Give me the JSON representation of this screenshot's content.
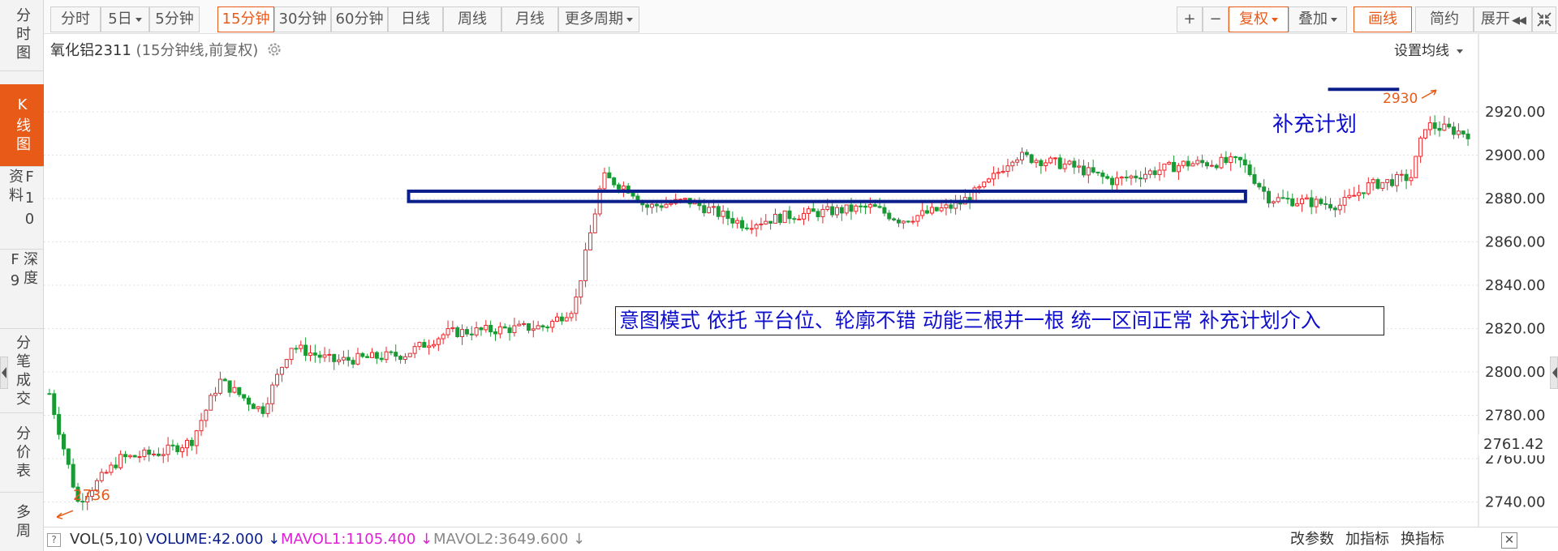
{
  "left_tabs": [
    {
      "label": "分时图",
      "active": false
    },
    {
      "label": "K线图",
      "active": true
    },
    {
      "label": "F10资料",
      "active": false
    },
    {
      "label": "深度F9",
      "active": false
    },
    {
      "label": "分笔成交",
      "active": false
    },
    {
      "label": "分价表",
      "active": false
    },
    {
      "label": "多周",
      "active": false
    }
  ],
  "toolbar": {
    "periods": [
      {
        "label": "分时",
        "dropdown": false,
        "active": false
      },
      {
        "label": "5日",
        "dropdown": true,
        "active": false
      },
      {
        "label": "5分钟",
        "dropdown": false,
        "active": false
      },
      {
        "label": "15分钟",
        "dropdown": false,
        "active": true
      },
      {
        "label": "30分钟",
        "dropdown": false,
        "active": false
      },
      {
        "label": "60分钟",
        "dropdown": false,
        "active": false
      },
      {
        "label": "日线",
        "dropdown": false,
        "active": false
      },
      {
        "label": "周线",
        "dropdown": false,
        "active": false
      },
      {
        "label": "月线",
        "dropdown": false,
        "active": false
      },
      {
        "label": "更多周期",
        "dropdown": true,
        "active": false
      }
    ],
    "zoom_in": "+",
    "zoom_out": "−",
    "fuquan": "复权",
    "overlay": "叠加",
    "draw_line": "画线",
    "simple": "简约",
    "expand": "展开",
    "expand_icon": "double-left-arrow",
    "fullscreen_icon": "shrink-arrows-icon"
  },
  "instrument": {
    "name": "氧化铝2311",
    "desc": "(15分钟线,前复权)"
  },
  "set_ma_label": "设置均线",
  "price_axis": {
    "ticks": [
      "2920.00",
      "2900.00",
      "2880.00",
      "2860.00",
      "2840.00",
      "2820.00",
      "2800.00",
      "2780.00",
      "2760.00",
      "2740.00"
    ],
    "current_price": "2761.42"
  },
  "annotations": {
    "box_text": "意图模式 依托 平台位、轮廓不错 动能三根并一根 统一区间正常 补充计划介入",
    "plan_text": "补充计划",
    "low_label": "2736",
    "high_label": "2930"
  },
  "volume_bar": {
    "help": "?",
    "vol": "VOL(5,10)",
    "volume": "VOLUME:42.000",
    "mavol1": "MAVOL1:1105.400",
    "mavol2": "MAVOL2:3649.600",
    "params": "改参数",
    "add_indicator": "加指标",
    "switch_indicator": "换指标",
    "close": "✕"
  },
  "colors": {
    "up": "#e8262b",
    "down": "#1a9a35",
    "accent": "#e85a17",
    "annotation": "#1010cc",
    "magenta": "#e01fd7",
    "navy": "#0a1f8c"
  },
  "chart_data": {
    "type": "candlestick",
    "y_unit": "price",
    "ylim": [
      2730,
      2935
    ],
    "ticks": [
      2740,
      2760,
      2780,
      2800,
      2820,
      2840,
      2860,
      2880,
      2900,
      2920
    ],
    "segments": [
      {
        "from": 0,
        "to": 2790
      },
      {
        "from": 0.02,
        "to": 2740
      },
      {
        "from": 0.05,
        "to": 2760
      },
      {
        "from": 0.08,
        "to": 2763
      },
      {
        "from": 0.1,
        "to": 2768
      },
      {
        "from": 0.12,
        "to": 2796
      },
      {
        "from": 0.15,
        "to": 2782
      },
      {
        "from": 0.17,
        "to": 2812
      },
      {
        "from": 0.2,
        "to": 2805
      },
      {
        "from": 0.25,
        "to": 2808
      },
      {
        "from": 0.28,
        "to": 2818
      },
      {
        "from": 0.35,
        "to": 2821
      },
      {
        "from": 0.37,
        "to": 2830
      },
      {
        "from": 0.39,
        "to": 2890
      },
      {
        "from": 0.41,
        "to": 2884
      },
      {
        "from": 0.42,
        "to": 2876
      },
      {
        "from": 0.45,
        "to": 2879
      },
      {
        "from": 0.49,
        "to": 2868
      },
      {
        "from": 0.52,
        "to": 2872
      },
      {
        "from": 0.58,
        "to": 2876
      },
      {
        "from": 0.6,
        "to": 2870
      },
      {
        "from": 0.64,
        "to": 2877
      },
      {
        "from": 0.66,
        "to": 2886
      },
      {
        "from": 0.68,
        "to": 2900
      },
      {
        "from": 0.72,
        "to": 2895
      },
      {
        "from": 0.75,
        "to": 2888
      },
      {
        "from": 0.8,
        "to": 2896
      },
      {
        "from": 0.84,
        "to": 2897
      },
      {
        "from": 0.86,
        "to": 2880
      },
      {
        "from": 0.91,
        "to": 2877
      },
      {
        "from": 0.93,
        "to": 2886
      },
      {
        "from": 0.96,
        "to": 2890
      },
      {
        "from": 0.97,
        "to": 2914
      },
      {
        "from": 1,
        "to": 2910
      }
    ],
    "support_zone": [
      2879,
      2883
    ],
    "high": 2930,
    "low": 2736
  }
}
